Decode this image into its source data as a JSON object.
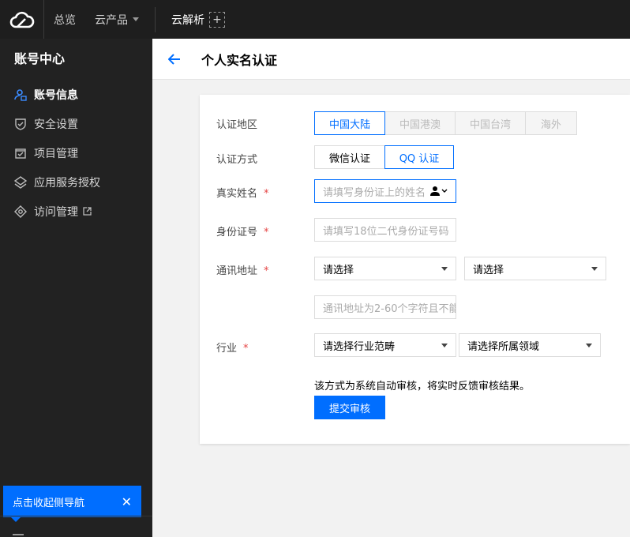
{
  "topbar": {
    "logo_icon": "cloud-icon",
    "overview": "总览",
    "products": "云产品",
    "dns": "云解析",
    "add_icon": "plus-icon"
  },
  "sidebar": {
    "title": "账号中心",
    "items": [
      {
        "label": "账号信息",
        "icon": "user-icon",
        "active": true
      },
      {
        "label": "安全设置",
        "icon": "shield-icon"
      },
      {
        "label": "项目管理",
        "icon": "folder-check-icon"
      },
      {
        "label": "应用服务授权",
        "icon": "layers-icon"
      },
      {
        "label": "访问管理",
        "icon": "access-icon",
        "external": true
      }
    ],
    "collapse_tip": "点击收起侧导航"
  },
  "header": {
    "title": "个人实名认证"
  },
  "form": {
    "region": {
      "label": "认证地区",
      "options": [
        "中国大陆",
        "中国港澳",
        "中国台湾",
        "海外"
      ],
      "selected": "中国大陆"
    },
    "method": {
      "label": "认证方式",
      "options": [
        "微信认证",
        "QQ 认证"
      ],
      "selected": "QQ 认证"
    },
    "name": {
      "label": "真实姓名",
      "placeholder": "请填写身份证上的姓名"
    },
    "id_number": {
      "label": "身份证号",
      "placeholder": "请填写18位二代身份证号码"
    },
    "address": {
      "label": "通讯地址",
      "select1": "请选择",
      "select2": "请选择",
      "placeholder": "通讯地址为2-60个字符且不能"
    },
    "industry": {
      "label": "行业",
      "select1": "请选择行业范畴",
      "select2": "请选择所属领域"
    },
    "required_mark": "*",
    "hint": "该方式为系统自动审核，将实时反馈审核结果。",
    "submit": "提交审核"
  },
  "colors": {
    "accent": "#006eff",
    "topbar": "#1e1e1e",
    "sidebar": "#222222",
    "required": "#e54545"
  }
}
